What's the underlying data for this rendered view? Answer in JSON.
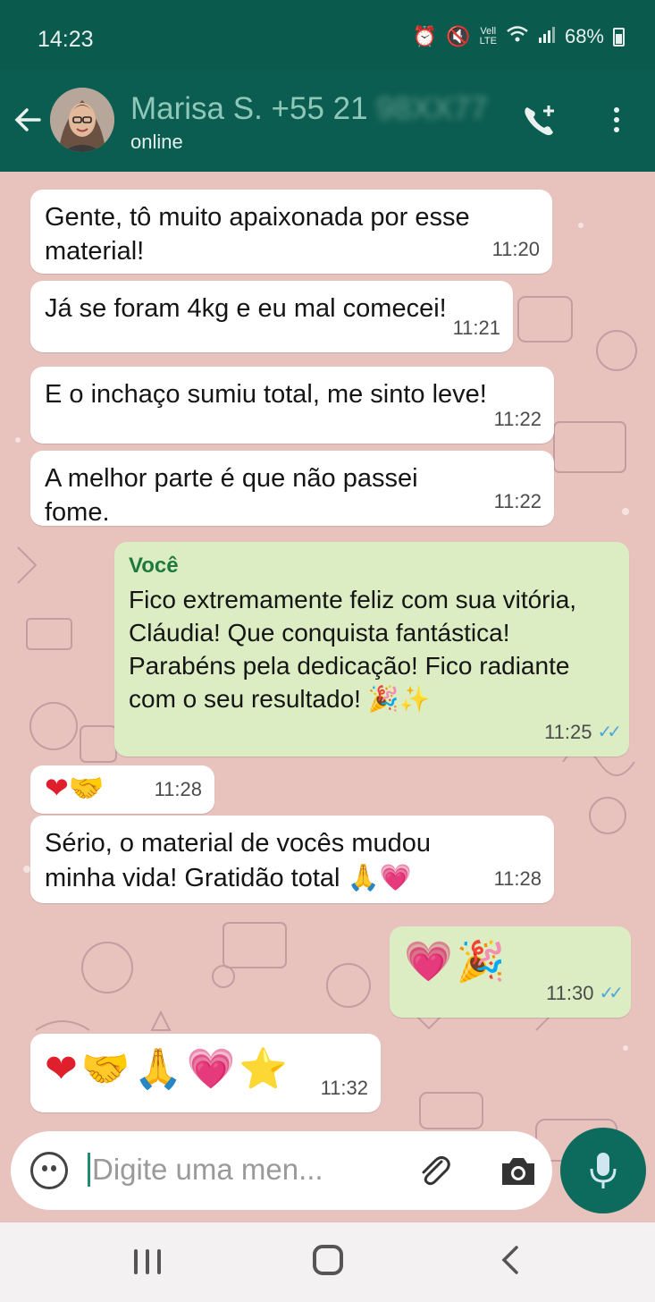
{
  "status_bar": {
    "time": "14:23",
    "network": "Vell\nLTE",
    "battery": "68%"
  },
  "header": {
    "contact_name": "Marisa S. +55 21",
    "contact_number_blurred": "98XX77",
    "status": "online"
  },
  "messages": [
    {
      "direction": "in",
      "text": "Gente, tô muito apaixonada por esse material!",
      "time": "11:20"
    },
    {
      "direction": "in",
      "text": "Já se foram 4kg e eu mal comecei!",
      "time": "11:21"
    },
    {
      "direction": "in",
      "text": "E o inchaço sumiu total, me sinto leve!",
      "time": "11:22"
    },
    {
      "direction": "in",
      "text": "A melhor parte é que não passei fome.",
      "time": "11:22"
    },
    {
      "direction": "out",
      "sender": "Você",
      "text": "Fico extremamente feliz com sua vitória, Cláudia! Que conquista fantástica! Parabéns pela dedicação! Fico radiante com o seu resultado!",
      "emojis": "🎉✨",
      "time": "11:25",
      "ticks": "✓✓"
    },
    {
      "direction": "in",
      "emojis": "❤🤝",
      "time": "11:28"
    },
    {
      "direction": "in",
      "text": "Sério, o material de vocês mudou minha vida! Gratidão total",
      "emojis": "🙏💗",
      "time": "11:28"
    },
    {
      "direction": "out",
      "emojis": "💗🎉",
      "time": "11:30",
      "ticks": "✓✓"
    },
    {
      "direction": "in",
      "emojis": "❤🤝🙏💗⭐",
      "time": "11:32"
    }
  ],
  "composer": {
    "placeholder": "Digite uma men..."
  },
  "icons": {
    "back": "arrow-left-icon",
    "call": "add-call-icon",
    "menu": "more-vert-icon",
    "emoji": "emoji-icon",
    "attach": "attach-icon",
    "camera": "camera-icon",
    "mic": "mic-icon"
  },
  "colors": {
    "header": "#0c5d51",
    "outgoing_bubble": "#dcedc3",
    "incoming_bubble": "#ffffff",
    "read_ticks": "#4fa6d9",
    "sender_name": "#1e7a3c"
  }
}
